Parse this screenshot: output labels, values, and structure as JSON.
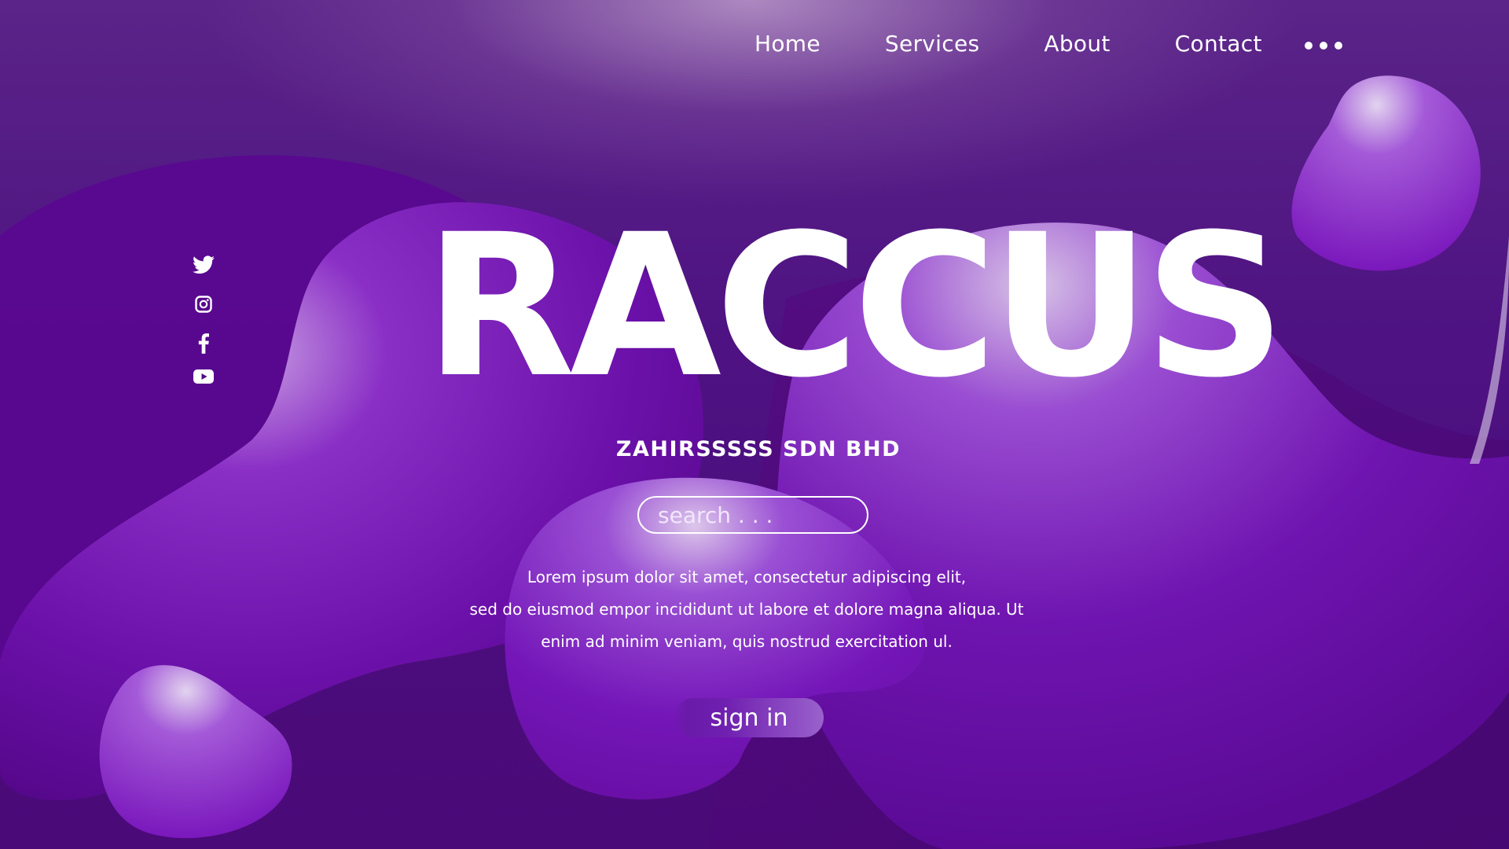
{
  "nav": {
    "items": [
      {
        "label": "Home"
      },
      {
        "label": "Services"
      },
      {
        "label": "About"
      },
      {
        "label": "Contact"
      }
    ],
    "more_icon": "more-dots-icon"
  },
  "social": [
    "twitter-icon",
    "instagram-icon",
    "facebook-icon",
    "youtube-icon"
  ],
  "hero": {
    "title": "RACCUS",
    "subtitle": "ZAHIRSSSSS SDN BHD",
    "search_placeholder": "search . . .",
    "body_lines": [
      "Lorem ipsum dolor sit amet, consectetur adipiscing elit,",
      "sed do eiusmod empor incididunt ut labore et dolore magna aliqua. Ut",
      "enim ad minim veniam, quis nostrud exercitation ul."
    ],
    "signin_label": "sign in"
  },
  "colors": {
    "background": "#4a0a78",
    "blob_light": "#a458d8",
    "blob_dark": "#5a0a90",
    "text": "#ffffff"
  }
}
